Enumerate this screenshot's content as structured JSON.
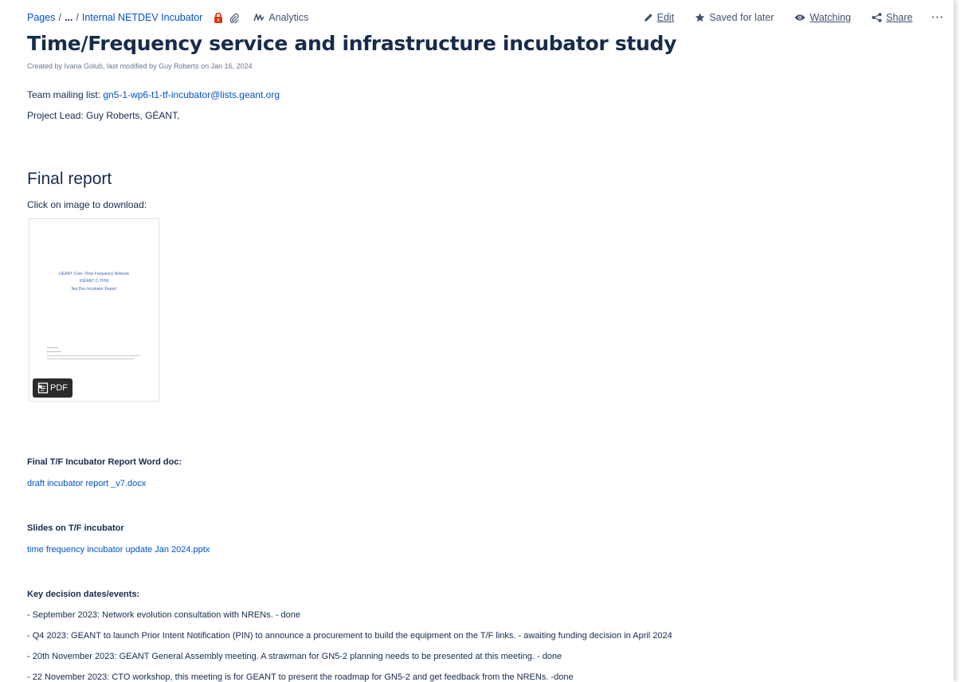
{
  "breadcrumb": {
    "root": "Pages",
    "ellipsis": "...",
    "parent": "Internal NETDEV Incubator"
  },
  "toolbar": {
    "analytics": "Analytics",
    "edit": "Edit",
    "saved": "Saved for later",
    "watching": "Watching",
    "share": "Share",
    "more": "···"
  },
  "page": {
    "title": "Time/Frequency service and infrastructure incubator study",
    "byline": "Created by Ivana Golub, last modified by Guy Roberts on Jan 16, 2024",
    "mailing_label": "Team mailing list:",
    "mailing_address": "gn5-1-wp6-t1-tf-incubator@lists.geant.org",
    "project_lead": "Project Lead: Guy Roberts, GÉANT,"
  },
  "final_report": {
    "heading": "Final report",
    "instruction": "Click on image to download:",
    "thumb_line1": "GEANT Core -Time Frequency Network",
    "thumb_line2": "(GÉANT C-TFN)",
    "thumb_line3": "Net Dev Incubator Report",
    "pdf_label": "PDF"
  },
  "word_doc": {
    "label": "Final T/F Incubator Report Word doc:",
    "link": "draft incubator report _v7.docx"
  },
  "slides": {
    "label": "Slides on T/F incubator",
    "link": "time frequency incubator update Jan 2024.pptx"
  },
  "key_dates": {
    "label": "Key decision dates/events:",
    "events": [
      " - September 2023: Network evolution consultation with NRENs.  - done",
      " - Q4 2023: GEANT to launch Prior Intent Notification (PIN) to announce a procurement to build the equipment on the T/F links. - awaiting funding decision in April 2024",
      " - 20th November 2023: GEANT General Assembly meeting.  A strawman for GN5-2 planning needs to be presented at this meeting. - done",
      " - 22 November 2023: CTO workshop, this meeting is for GEANT to present the roadmap for GN5-2 and get feedback from the NRENs. -done"
    ]
  },
  "colors": {
    "link": "#0052cc",
    "text": "#172b4d",
    "lock": "#de350b"
  }
}
